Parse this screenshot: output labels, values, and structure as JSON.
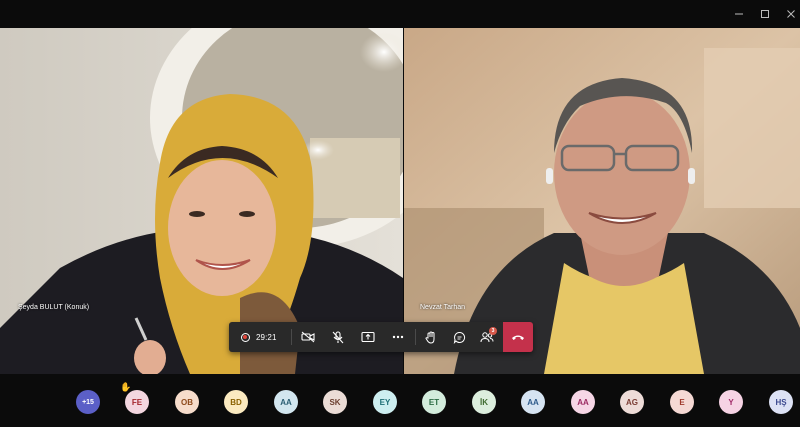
{
  "window": {
    "minimize_icon": "minimize-icon",
    "maximize_icon": "maximize-icon",
    "close_icon": "close-icon"
  },
  "participants_video": [
    {
      "name": "Şeyda BULUT (Konuk)"
    },
    {
      "name": "Nevzat Tarhan"
    }
  ],
  "controls": {
    "timer": "29:21",
    "participants_badge": "3",
    "icons": [
      "record-icon",
      "camera-off-icon",
      "mic-off-icon",
      "share-screen-icon",
      "more-icon",
      "raise-hand-icon",
      "chat-icon",
      "participants-icon",
      "hang-up-icon"
    ],
    "hangup_color": "#c4314b"
  },
  "strip": {
    "more_label": "+15",
    "avatars": [
      {
        "initials": "FE",
        "bg": "#f3d6df",
        "fg": "#a4262c"
      },
      {
        "initials": "OB",
        "bg": "#f6dccb",
        "fg": "#8e4a1b"
      },
      {
        "initials": "BD",
        "bg": "#fbeac0",
        "fg": "#8a6100"
      },
      {
        "initials": "AA",
        "bg": "#d2e6ef",
        "fg": "#2b5e73"
      },
      {
        "initials": "SK",
        "bg": "#ebdcd6",
        "fg": "#6b3e2e"
      },
      {
        "initials": "EY",
        "bg": "#cdeef0",
        "fg": "#1e6e75"
      },
      {
        "initials": "ET",
        "bg": "#d3ecdc",
        "fg": "#2c6b44"
      },
      {
        "initials": "İK",
        "bg": "#dceedd",
        "fg": "#3e6b2f"
      },
      {
        "initials": "AA",
        "bg": "#d6e4f2",
        "fg": "#2d5a8a"
      },
      {
        "initials": "AA",
        "bg": "#f6d6e6",
        "fg": "#9b2b62"
      },
      {
        "initials": "AG",
        "bg": "#eedcd8",
        "fg": "#7a3c33"
      },
      {
        "initials": "E",
        "bg": "#f5d9d4",
        "fg": "#a03a2c"
      },
      {
        "initials": "Y",
        "bg": "#f6d3e4",
        "fg": "#a12a68"
      },
      {
        "initials": "HŞ",
        "bg": "#dde2f5",
        "fg": "#3d4a8f"
      }
    ]
  }
}
